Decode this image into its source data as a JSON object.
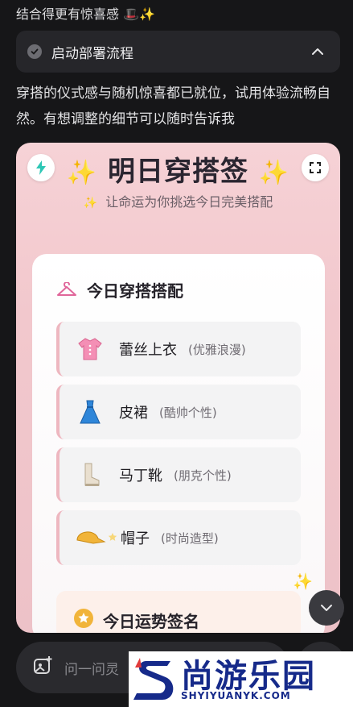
{
  "top_text": "结合得更有惊喜感 🎩✨",
  "workflow": {
    "label": "启动部署流程"
  },
  "message": "穿搭的仪式感与随机惊喜都已就位，试用体验流畅自然。有想调整的细节可以随时告诉我",
  "card": {
    "title": "明日穿搭签",
    "subtitle": "让命运为你挑选今日完美搭配",
    "outfit_section_title": "今日穿搭搭配",
    "items": [
      {
        "name": "蕾丝上衣",
        "desc": "(优雅浪漫)",
        "icon": "blouse-icon"
      },
      {
        "name": "皮裙",
        "desc": "(酷帅个性)",
        "icon": "dress-icon"
      },
      {
        "name": "马丁靴",
        "desc": "(朋克个性)",
        "icon": "boot-icon"
      },
      {
        "name": "帽子",
        "desc": "(时尚造型)",
        "icon": "cap-icon"
      }
    ],
    "fortune_title": "今日运势签名",
    "colors": {
      "accent_pink": "#eeb7c0",
      "star_gold": "#f1b43a",
      "card_bg": "#f2c8cd"
    }
  },
  "input": {
    "placeholder": "问一问灵"
  },
  "watermark": {
    "brand": "尚游乐园",
    "url": "SHYIYUANYK.COM"
  }
}
